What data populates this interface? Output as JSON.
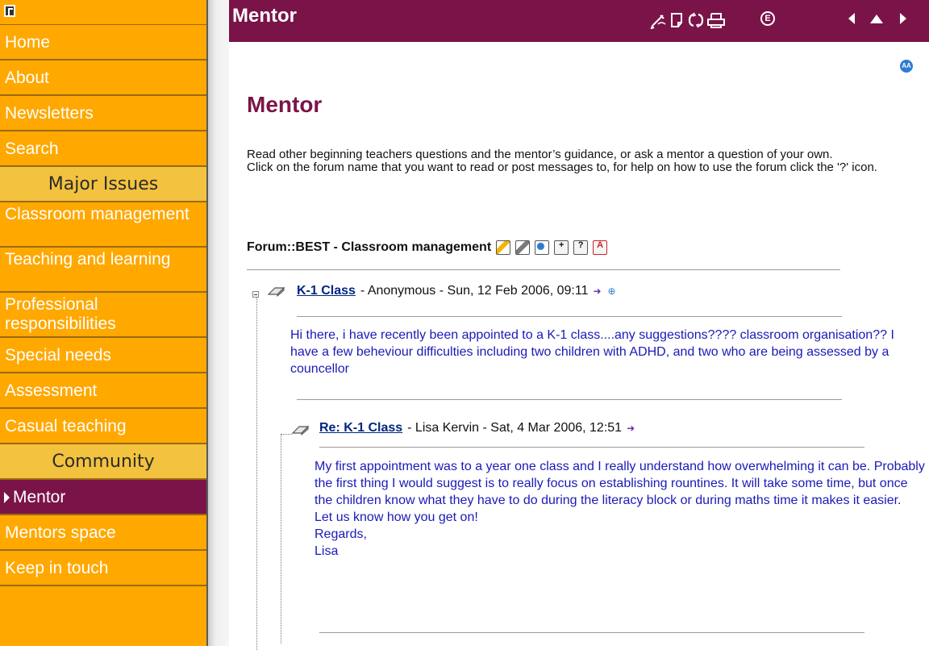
{
  "sidebar": {
    "items": [
      {
        "label": "Home"
      },
      {
        "label": "About"
      },
      {
        "label": "Newsletters"
      },
      {
        "label": "Search"
      }
    ],
    "major_issues_heading": "Major Issues",
    "major_issues": [
      {
        "label": "Classroom management"
      },
      {
        "label": "Teaching and learning"
      },
      {
        "label": "Professional responsibilities"
      },
      {
        "label": "Special needs"
      },
      {
        "label": "Assessment"
      },
      {
        "label": "Casual teaching"
      }
    ],
    "community_heading": "Community",
    "community": [
      {
        "label": "Mentor",
        "active": true
      },
      {
        "label": "Mentors space"
      },
      {
        "label": "Keep in touch"
      }
    ]
  },
  "header": {
    "title": "Mentor",
    "e_icon_label": "E"
  },
  "content": {
    "aa_label": "AA",
    "title": "Mentor",
    "intro_line1": "Read other beginning teachers questions and the mentor’s guidance, or ask a mentor a question of your own.",
    "intro_line2": "Click on the forum name that you want to read or post messages to, for help on how to use the forum click the '?' icon.",
    "forum_heading": "Forum::BEST - Classroom management",
    "posts": [
      {
        "subject": "K-1 Class",
        "meta": "- Anonymous - Sun, 12 Feb 2006, 09:11",
        "body": "Hi there, i have recently been appointed to a K-1 class....any suggestions???? classroom organisation?? I have a few beheviour difficulties including two children with ADHD, and two who are being assessed by a councellor"
      },
      {
        "subject": "Re: K-1 Class",
        "meta": "- Lisa Kervin - Sat, 4 Mar 2006, 12:51",
        "body": "My first appointment was to a year one class and I really understand how overwhelming it can be. Probably the first thing I would suggest is to really focus on establishing rountines. It will take some time, but once the children know what they have to do during the literacy block or during maths time it makes it easier.",
        "body2": "Let us know how you get on!",
        "body3": "Regards,",
        "body4": "Lisa"
      }
    ]
  },
  "colors": {
    "sidebar_bg": "#ffa800",
    "section_bg": "#f3c23f",
    "brand": "#7a1448",
    "link": "#00267f",
    "message_text": "#1a1ab8"
  },
  "icons": [
    "sidebar-toggle-icon",
    "edit-icon",
    "document-icon",
    "refresh-icon",
    "print-icon",
    "e-icon",
    "prev-arrow-icon",
    "up-arrow-icon",
    "next-arrow-icon",
    "text-size-icon",
    "forum-tool-icons",
    "collapse-icon",
    "pin-icon",
    "reply-icon",
    "expand-icon"
  ]
}
